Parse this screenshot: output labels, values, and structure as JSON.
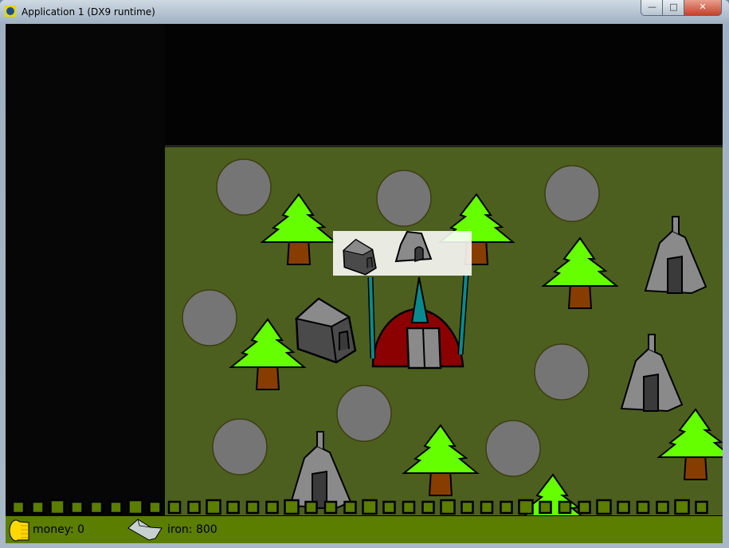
{
  "window": {
    "title": "Application 1 (DX9 runtime)",
    "minimize_label": "—",
    "maximize_label": "□",
    "close_label": "✕"
  },
  "hud": {
    "money_label": "money: 0",
    "iron_label": "iron: 800",
    "money_icon": "gold-coins-icon",
    "iron_icon": "iron-ingot-icon"
  },
  "build_menu": {
    "options": [
      "dark-hut-building",
      "stone-tent-building"
    ]
  },
  "colors": {
    "grass": "#4d5f1f",
    "hud": "#5b7d00",
    "tree": "#66ff00",
    "trunk": "#873d00",
    "rock": "#757575",
    "main_building": "#8b0000"
  }
}
